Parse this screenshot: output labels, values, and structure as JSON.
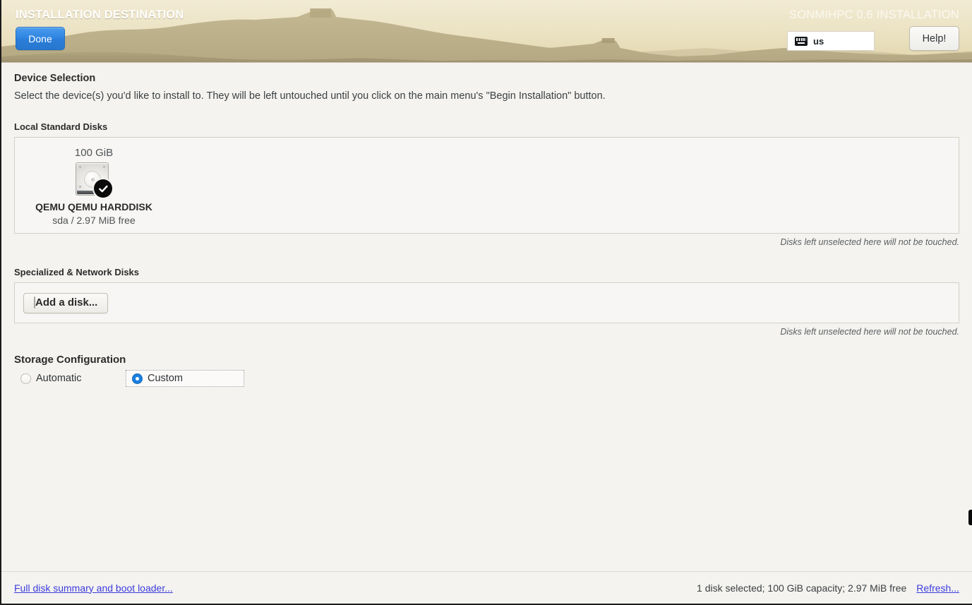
{
  "header": {
    "title": "INSTALLATION DESTINATION",
    "product_title": "SONMIHPC 0.6 INSTALLATION",
    "done_label": "Done",
    "help_label": "Help!",
    "keyboard_layout": "us",
    "keyboard_icon": "keyboard-icon",
    "accent_blue": "#2a7ed9",
    "background_top": "#efe7cd",
    "background_bottom": "#e3d9b4"
  },
  "main": {
    "section_title": "Device Selection",
    "section_desc": "Select the device(s) you'd like to install to.  They will be left untouched until you click on the main menu's \"Begin Installation\" button.",
    "local_disks": {
      "group_label": "Local Standard Disks",
      "note": "Disks left unselected here will not be touched.",
      "disks": [
        {
          "capacity": "100 GiB",
          "name": "QEMU QEMU HARDDISK",
          "meta": "sda   /   2.97 MiB free",
          "icon": "hard-disk-icon",
          "selected": true,
          "badge_icon": "checkmark-badge-icon"
        }
      ]
    },
    "specialized_disks": {
      "group_label": "Specialized & Network Disks",
      "add_disk_label": "Add a disk...",
      "add_disk_icon": "disk-drive-icon",
      "note": "Disks left unselected here will not be touched."
    },
    "storage_configuration": {
      "label": "Storage Configuration",
      "options": [
        {
          "label": "Automatic",
          "selected": false
        },
        {
          "label": "Custom",
          "selected": true
        }
      ],
      "selected_value": "Custom",
      "selected_color": "#1b7fe0"
    }
  },
  "footer": {
    "summary_link": "Full disk summary and boot loader...",
    "status": "1 disk selected; 100 GiB capacity; 2.97 MiB free",
    "refresh_link": "Refresh...",
    "link_color": "#3c3cdc"
  }
}
